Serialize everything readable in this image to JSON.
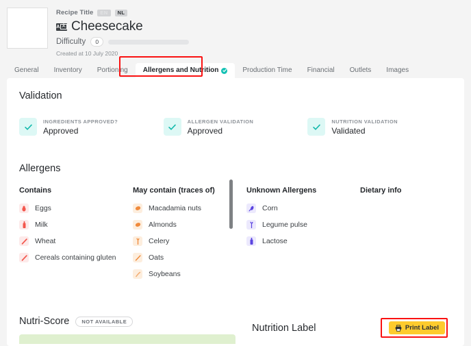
{
  "header": {
    "recipe_title_label": "Recipe Title",
    "languages": [
      {
        "code": "EN",
        "active": false
      },
      {
        "code": "NL",
        "active": true
      }
    ],
    "translate_icon": {
      "left": "A",
      "right": "文"
    },
    "title": "Cheesecake",
    "difficulty_label": "Difficulty",
    "difficulty_value": "0",
    "created_at": "Created at 10 July 2020",
    "thumbnail": "recipe-thumbnail-placeholder"
  },
  "tabs": [
    {
      "label": "General",
      "active": false
    },
    {
      "label": "Inventory",
      "active": false
    },
    {
      "label": "Portioning",
      "active": false
    },
    {
      "label": "Allergens and Nutrition",
      "active": true,
      "validated": true
    },
    {
      "label": "Production Time",
      "active": false
    },
    {
      "label": "Financial",
      "active": false
    },
    {
      "label": "Outlets",
      "active": false
    },
    {
      "label": "Images",
      "active": false
    }
  ],
  "validation": {
    "heading": "Validation",
    "items": [
      {
        "label": "INGREDIENTS APPROVED?",
        "value": "Approved",
        "icon": "check-icon"
      },
      {
        "label": "ALLERGEN VALIDATION",
        "value": "Approved",
        "icon": "check-icon"
      },
      {
        "label": "NUTRITION VALIDATION",
        "value": "Validated",
        "icon": "check-icon"
      }
    ]
  },
  "allergens": {
    "heading": "Allergens",
    "columns": [
      {
        "title": "Contains",
        "kind": "contains",
        "items": [
          {
            "name": "Eggs",
            "icon": "egg-icon"
          },
          {
            "name": "Milk",
            "icon": "milk-bottle-icon"
          },
          {
            "name": "Wheat",
            "icon": "wheat-icon"
          },
          {
            "name": "Cereals containing gluten",
            "icon": "wheat-icon"
          }
        ]
      },
      {
        "title": "May contain (traces of)",
        "kind": "traces",
        "items": [
          {
            "name": "Macadamia nuts",
            "icon": "nut-icon"
          },
          {
            "name": "Almonds",
            "icon": "nut-icon"
          },
          {
            "name": "Celery",
            "icon": "celery-icon"
          },
          {
            "name": "Oats",
            "icon": "oat-icon"
          },
          {
            "name": "Soybeans",
            "icon": "soybean-icon"
          }
        ]
      },
      {
        "title": "Unknown Allergens",
        "kind": "unknown",
        "items": [
          {
            "name": "Corn",
            "icon": "corn-icon"
          },
          {
            "name": "Legume pulse",
            "icon": "legume-icon"
          },
          {
            "name": "Lactose",
            "icon": "milk-bottle-icon"
          }
        ]
      },
      {
        "title": "Dietary info",
        "kind": "dietary",
        "items": []
      }
    ]
  },
  "nutri_score": {
    "heading": "Nutri-Score",
    "badge": "NOT AVAILABLE"
  },
  "nutrition_label": {
    "heading": "Nutrition Label",
    "print_button": "Print Label",
    "print_icon": "printer-icon"
  },
  "colors": {
    "accent_teal": "#14c1b4",
    "contains_red": "#f3564c",
    "traces_orange": "#f08a3c",
    "unknown_purple": "#5b45e0",
    "print_yellow": "#fecb2e",
    "annotation_red": "#fa1111"
  }
}
